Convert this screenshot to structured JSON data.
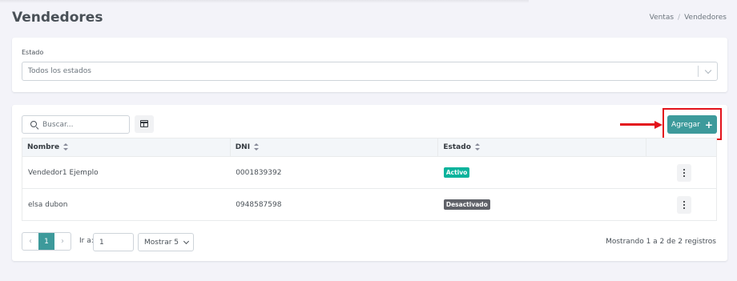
{
  "header": {
    "title": "Vendedores",
    "breadcrumb": [
      "Ventas",
      "Vendedores"
    ]
  },
  "filter": {
    "label": "Estado",
    "selected": "Todos los estados"
  },
  "toolbar": {
    "search_placeholder": "Buscar...",
    "columns_icon": "table-columns-icon",
    "add_label": "Agregar",
    "add_icon": "+"
  },
  "table": {
    "columns": [
      "Nombre",
      "DNI",
      "Estado",
      ""
    ],
    "rows": [
      {
        "name": "Vendedor1 Ejemplo",
        "dni": "0001839392",
        "status": "Activo",
        "status_color": "#0ab39c"
      },
      {
        "name": "elsa dubon",
        "dni": "0948587598",
        "status": "Desactivado",
        "status_color": "#5f6168"
      }
    ]
  },
  "pagination": {
    "prev": "‹",
    "next": "›",
    "current_page": "1",
    "goto_label": "Ir a:",
    "goto_value": "1",
    "page_size_label": "Mostrar 5",
    "records_text": "Mostrando 1 a 2 de 2 registros"
  },
  "colors": {
    "accent": "#3d9a9b",
    "highlight": "#e3131b"
  }
}
